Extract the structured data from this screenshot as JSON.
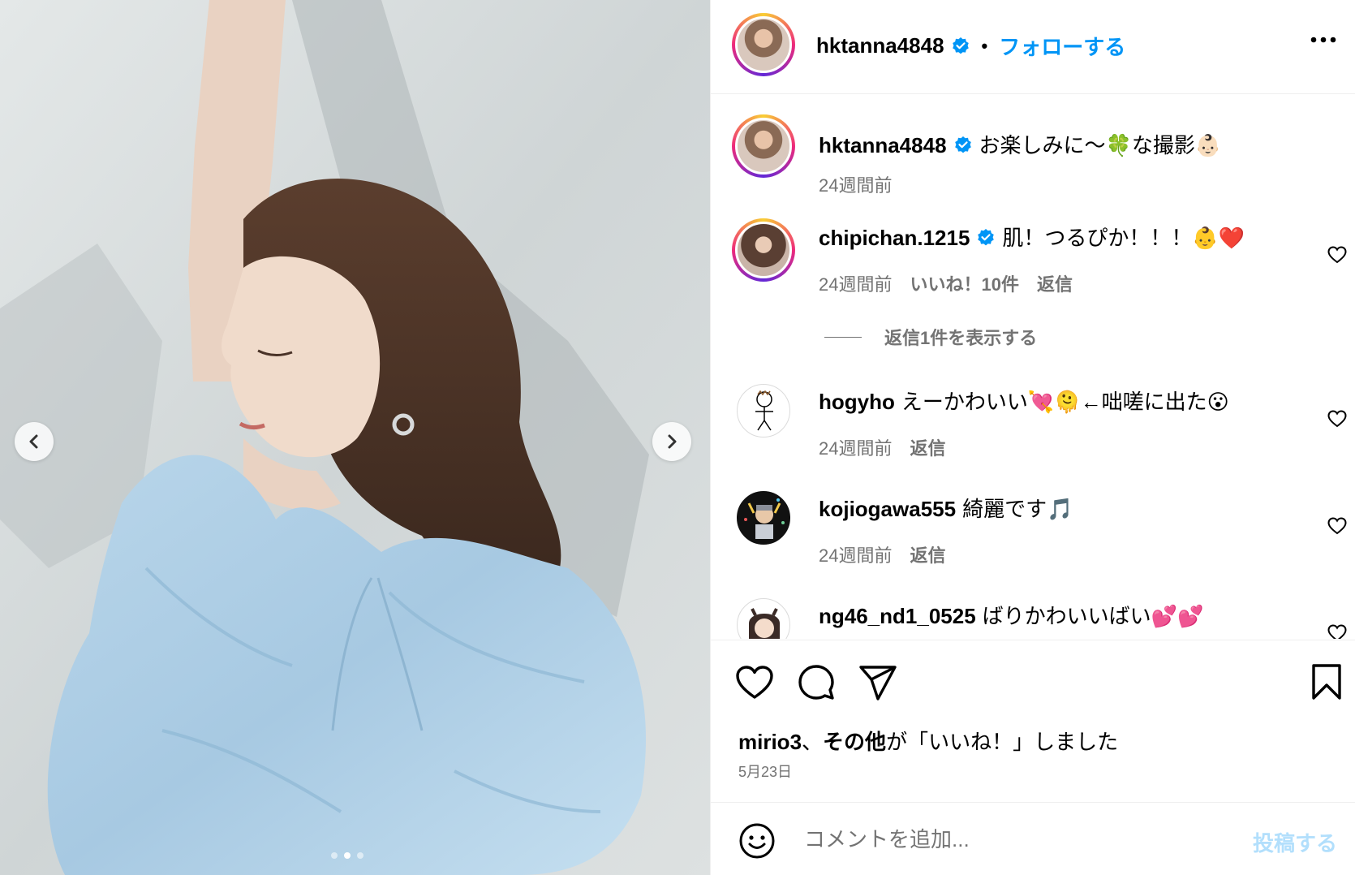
{
  "post": {
    "photo_alt": "",
    "slide_count": 3,
    "active_slide": 2
  },
  "header": {
    "username": "hktanna4848",
    "separator": "•",
    "follow_label": "フォローする"
  },
  "comments": [
    {
      "username": "hktanna4848",
      "verified": true,
      "text": "お楽しみに〜🍀な撮影👶🏻",
      "time": "24週間前"
    },
    {
      "username": "chipichan.1215",
      "verified": true,
      "text": "肌！つるぴか！！！👶❤️",
      "time": "24週間前",
      "likes": "いいね！10件",
      "reply": "返信"
    },
    {
      "username": "hogyho",
      "verified": false,
      "text": "えーかわいい💘🫠←咄嗟に出た😮",
      "time": "24週間前",
      "reply": "返信"
    },
    {
      "username": "kojiogawa555",
      "verified": false,
      "text": "綺麗です🎵",
      "time": "24週間前",
      "reply": "返信"
    },
    {
      "username": "ng46_nd1_0525",
      "verified": false,
      "text": "ばりかわいいばい💕💕"
    }
  ],
  "view_replies_label": "返信1件を表示する",
  "likes": {
    "user": "mirio3",
    "sep": "、",
    "others": "その他",
    "suffix": "が「いいね！」しました"
  },
  "date": "5月23日",
  "composer": {
    "placeholder": "コメントを追加...",
    "post_label": "投稿する"
  },
  "colors": {
    "link_blue": "#0095f6",
    "post_disabled": "#b2dffc",
    "meta_gray": "#737373"
  }
}
